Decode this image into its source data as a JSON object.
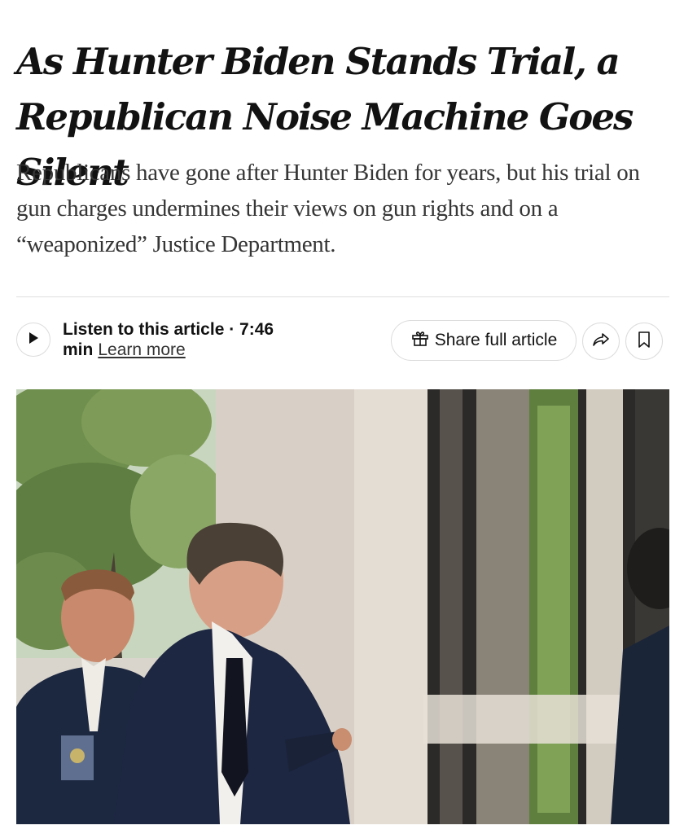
{
  "article": {
    "headline": "As Hunter Biden Stands Trial, a Republican Noise Machine Goes Silent",
    "summary": "Republicans have gone after Hunter Biden for years, but his trial on gun charges undermines their views on gun rights and on a “weaponized” Justice Department."
  },
  "audio": {
    "listen_label": "Listen to this article · 7:46 min",
    "learn_more": "Learn more"
  },
  "actions": {
    "share_full": "Share full article",
    "share_icon": "share-arrow-icon",
    "bookmark_icon": "bookmark-icon",
    "gift_icon": "gift-icon",
    "play_icon": "play-icon"
  },
  "colors": {
    "text": "#121212",
    "summary": "#363636",
    "border": "#dcdcdc"
  }
}
